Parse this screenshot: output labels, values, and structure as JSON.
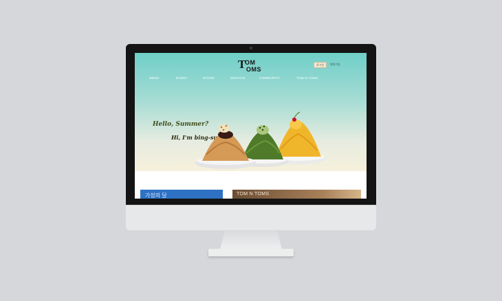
{
  "brand": {
    "line1": "OM",
    "line2": "OMS",
    "initial": "T"
  },
  "header": {
    "login_label": "로그인",
    "join_label": "회원가입"
  },
  "nav": {
    "items": [
      "MENU",
      "EVENT",
      "STORE",
      "SERVICE",
      "COMMUNITY",
      "TOM N TOMS"
    ]
  },
  "hero": {
    "line1": "Hello, Summer?",
    "line2": "Hi, I'm bing-su!"
  },
  "sections": {
    "left_card": "가정의 달",
    "right_card": "TOM N TOMS"
  },
  "colors": {
    "hero_top": "#6fcfc8",
    "hero_bottom": "#f6f0dc",
    "left_card": "#2f72c4",
    "right_card": "#8c6a48"
  }
}
